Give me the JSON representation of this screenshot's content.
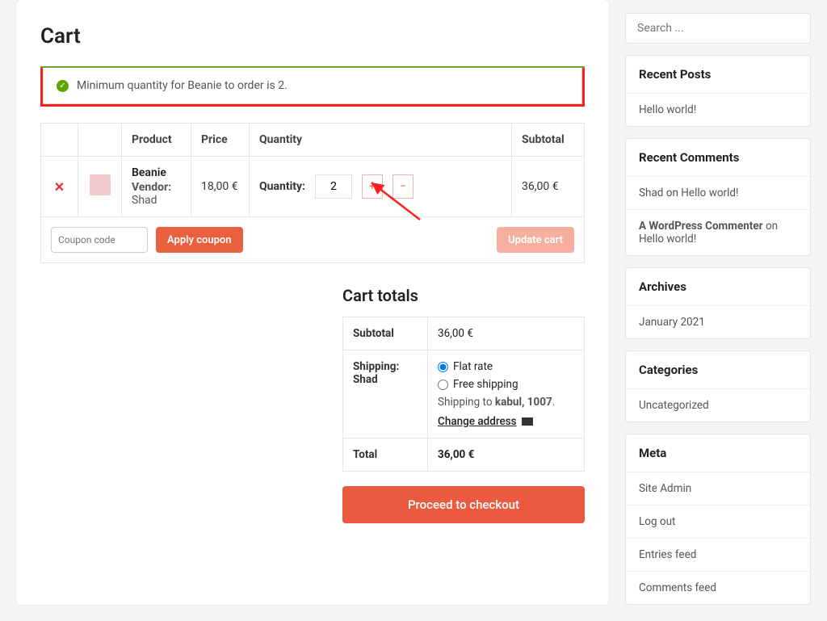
{
  "page": {
    "title": "Cart"
  },
  "notice": {
    "text": "Minimum quantity for Beanie to order is 2."
  },
  "table": {
    "headers": {
      "product": "Product",
      "price": "Price",
      "quantity": "Quantity",
      "subtotal": "Subtotal"
    },
    "item": {
      "name": "Beanie",
      "vendor_label": "Vendor:",
      "vendor": "Shad",
      "price": "18,00 €",
      "qty_label": "Quantity:",
      "qty": "2",
      "subtotal": "36,00 €"
    },
    "coupon_placeholder": "Coupon code",
    "apply": "Apply coupon",
    "update": "Update cart"
  },
  "totals": {
    "title": "Cart totals",
    "subtotal_label": "Subtotal",
    "subtotal": "36,00 €",
    "shipping_label": "Shipping: Shad",
    "opt_flat": "Flat rate",
    "opt_free": "Free shipping",
    "ship_to_pre": "Shipping to ",
    "ship_to_bold": "kabul, 1007",
    "change": "Change address",
    "total_label": "Total",
    "total": "36,00 €",
    "checkout": "Proceed to checkout"
  },
  "sidebar": {
    "search_placeholder": "Search ...",
    "recent_posts": {
      "title": "Recent Posts",
      "items": [
        "Hello world!"
      ]
    },
    "recent_comments": {
      "title": "Recent Comments",
      "items": [
        {
          "author": "Shad",
          "on": "on",
          "post": "Hello world!"
        },
        {
          "author": "A WordPress Commenter",
          "on": "on",
          "post": "Hello world!"
        }
      ]
    },
    "archives": {
      "title": "Archives",
      "items": [
        "January 2021"
      ]
    },
    "categories": {
      "title": "Categories",
      "items": [
        "Uncategorized"
      ]
    },
    "meta": {
      "title": "Meta",
      "items": [
        "Site Admin",
        "Log out",
        "Entries feed",
        "Comments feed"
      ]
    }
  }
}
